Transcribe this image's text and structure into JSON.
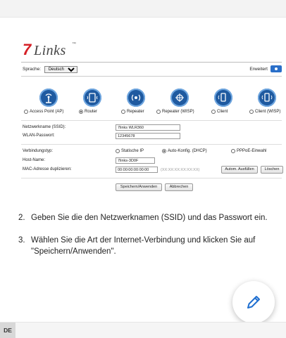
{
  "router_ui": {
    "logo_seven": "7",
    "logo_links": "Links",
    "logo_tm": "™",
    "language_label": "Sprache:",
    "language_selected": "Deutsch",
    "advanced_label": "Erweitert",
    "modes": [
      {
        "label": "Access Point (AP)",
        "icon": "access-point-icon",
        "selected": false
      },
      {
        "label": "Router",
        "icon": "router-icon",
        "selected": true
      },
      {
        "label": "Repeater",
        "icon": "repeater-icon",
        "selected": false
      },
      {
        "label": "Repeater (WISP)",
        "icon": "wisp-icon",
        "selected": false
      },
      {
        "label": "Client",
        "icon": "client-icon",
        "selected": false
      },
      {
        "label": "Client (WISP)",
        "icon": "client-wisp-icon",
        "selected": false
      }
    ],
    "network_name_label": "Netzwerkname (SSID):",
    "network_name_value": "7links WLR360",
    "wlan_password_label": "WLAN-Passwort:",
    "wlan_password_value": "12345678",
    "connection_type_label": "Verbindungstyp:",
    "connection_options": [
      {
        "label": "Statische IP",
        "selected": false
      },
      {
        "label": "Auto-Konfig. (DHCP)",
        "selected": true
      },
      {
        "label": "PPPoE-Einwahl",
        "selected": false
      }
    ],
    "host_name_label": "Host-Name:",
    "host_name_value": "7links-3D0F",
    "mac_label": "MAC-Adresse duplizieren:",
    "mac_value": "00:00:00:00:00:00",
    "mac_hint": "(XX:XX:XX:XX:XX:XX)",
    "autofill_button": "Autom. Ausfüllen",
    "delete_button": "Löschen",
    "save_button": "Speichern/Anwenden",
    "cancel_button": "Abbrechen"
  },
  "instructions": [
    {
      "num": "2.",
      "lines": [
        "Geben Sie die den Netzwerknamen (SSID) und das Passwort ein."
      ]
    },
    {
      "num": "3.",
      "lines": [
        "Wählen Sie die Art der Internet-Verbindung und klicken Sie auf",
        "\"Speichern/Anwenden\"."
      ]
    }
  ],
  "footer": {
    "language_code": "DE"
  },
  "colors": {
    "brand_red": "#d51f26",
    "icon_blue": "#1f5aa0",
    "toggle_blue": "#2a6fc9"
  },
  "fab": {
    "icon": "pencil-icon"
  }
}
